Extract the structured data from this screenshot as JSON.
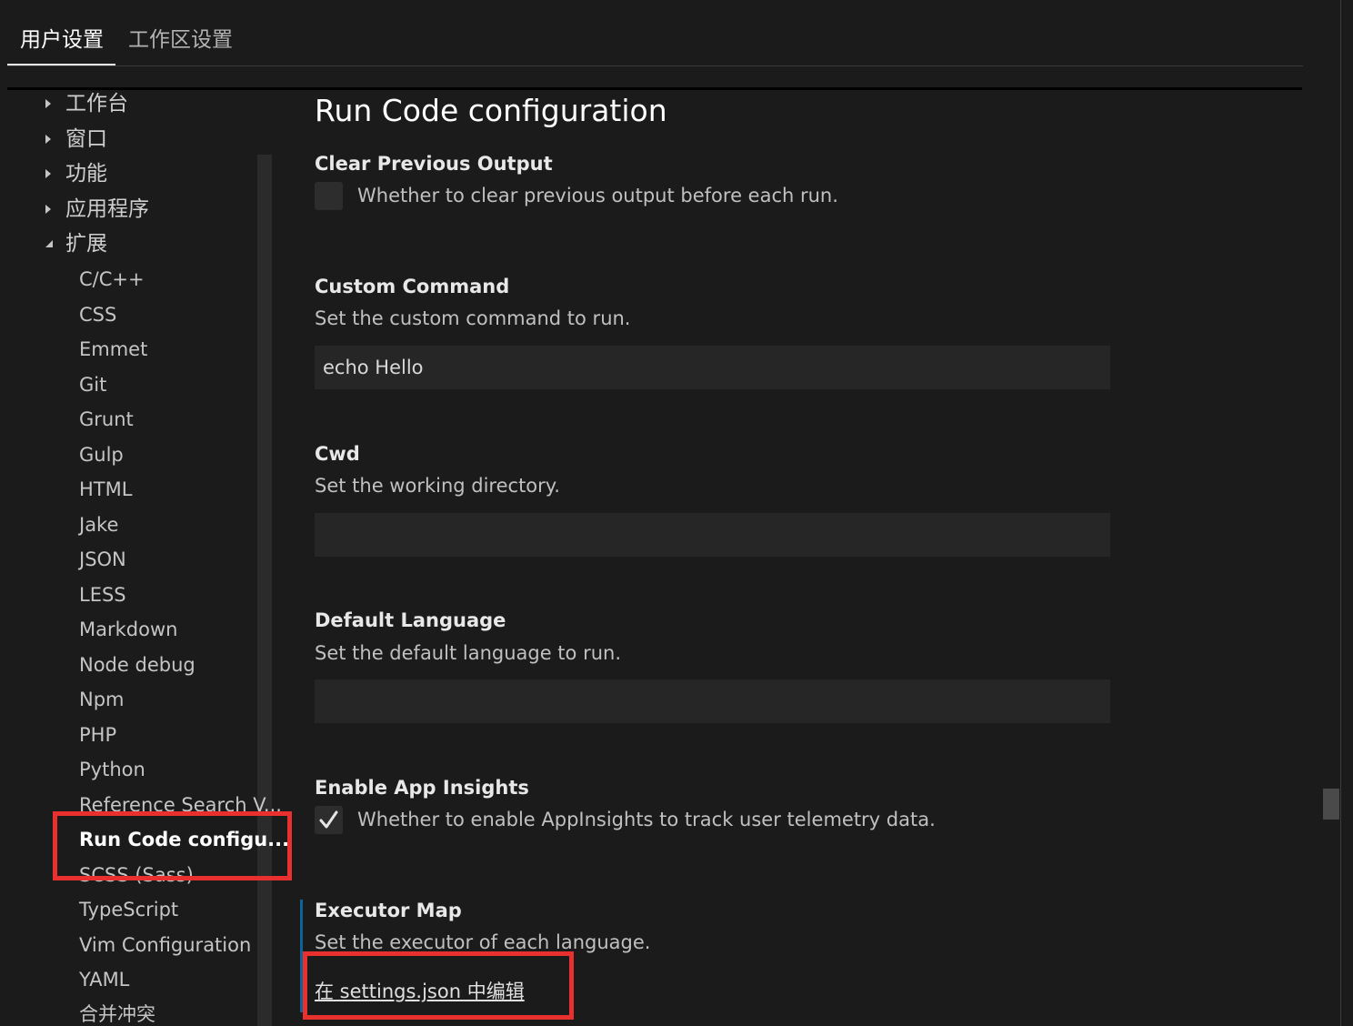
{
  "tabs": [
    {
      "label": "用户设置",
      "active": true
    },
    {
      "label": "工作区设置",
      "active": false
    }
  ],
  "tree": {
    "top_items": [
      {
        "label": "工作台",
        "expanded": false
      },
      {
        "label": "窗口",
        "expanded": false
      },
      {
        "label": "功能",
        "expanded": false
      },
      {
        "label": "应用程序",
        "expanded": false
      },
      {
        "label": "扩展",
        "expanded": true
      }
    ],
    "extensions": [
      "C/C++",
      "CSS",
      "Emmet",
      "Git",
      "Grunt",
      "Gulp",
      "HTML",
      "Jake",
      "JSON",
      "LESS",
      "Markdown",
      "Node debug",
      "Npm",
      "PHP",
      "Python",
      "Reference Search V...",
      "Run Code configu...",
      "SCSS (Sass)",
      "TypeScript",
      "Vim Configuration",
      "YAML",
      "合并冲突"
    ],
    "selected": "Run Code configu..."
  },
  "main": {
    "title": "Run Code configuration",
    "settings": {
      "clear_output": {
        "title": "Clear Previous Output",
        "desc": "Whether to clear previous output before each run.",
        "checked": false
      },
      "custom_command": {
        "title": "Custom Command",
        "desc": "Set the custom command to run.",
        "value": "echo Hello"
      },
      "cwd": {
        "title": "Cwd",
        "desc": "Set the working directory.",
        "value": ""
      },
      "default_language": {
        "title": "Default Language",
        "desc": "Set the default language to run.",
        "value": ""
      },
      "app_insights": {
        "title": "Enable App Insights",
        "desc": "Whether to enable AppInsights to track user telemetry data.",
        "checked": true
      },
      "executor_map": {
        "title": "Executor Map",
        "desc": "Set the executor of each language.",
        "link": "在 settings.json 中编辑"
      }
    }
  },
  "colors": {
    "background": "#1b1b1b",
    "highlight": "#e8312e",
    "focus": "#0e639c"
  }
}
